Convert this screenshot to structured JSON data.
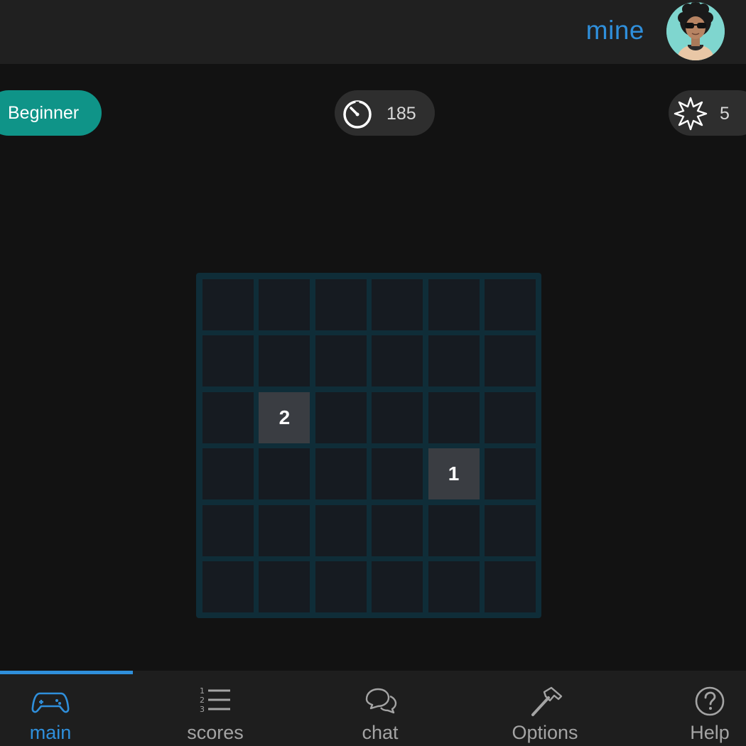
{
  "header": {
    "title": "mine",
    "avatar_icon": "user-avatar-sunglasses"
  },
  "status": {
    "level": "Beginner",
    "timer": "185",
    "timer_icon": "stopwatch-icon",
    "mines": "5",
    "mines_icon": "mine-burst-icon"
  },
  "board": {
    "rows": 6,
    "cols": 6,
    "cells": [
      [
        "",
        "",
        "",
        "",
        "",
        ""
      ],
      [
        "",
        "",
        "",
        "",
        "",
        ""
      ],
      [
        "",
        "2",
        "",
        "",
        "",
        ""
      ],
      [
        "",
        "",
        "",
        "",
        "1",
        ""
      ],
      [
        "",
        "",
        "",
        "",
        "",
        ""
      ],
      [
        "",
        "",
        "",
        "",
        "",
        ""
      ]
    ]
  },
  "nav": {
    "tabs": [
      {
        "label": "main",
        "icon": "gamepad-icon",
        "active": true
      },
      {
        "label": "scores",
        "icon": "numbered-list-icon",
        "active": false
      },
      {
        "label": "chat",
        "icon": "chat-bubbles-icon",
        "active": false
      },
      {
        "label": "Options",
        "icon": "hammer-icon",
        "active": false
      },
      {
        "label": "Help",
        "icon": "help-circle-icon",
        "active": false
      }
    ]
  },
  "colors": {
    "accent": "#2f8fdb",
    "level_pill": "#0f9488",
    "board_grid": "#0f2d38",
    "cell_hidden": "#161b21",
    "cell_revealed": "#3a3d42"
  }
}
